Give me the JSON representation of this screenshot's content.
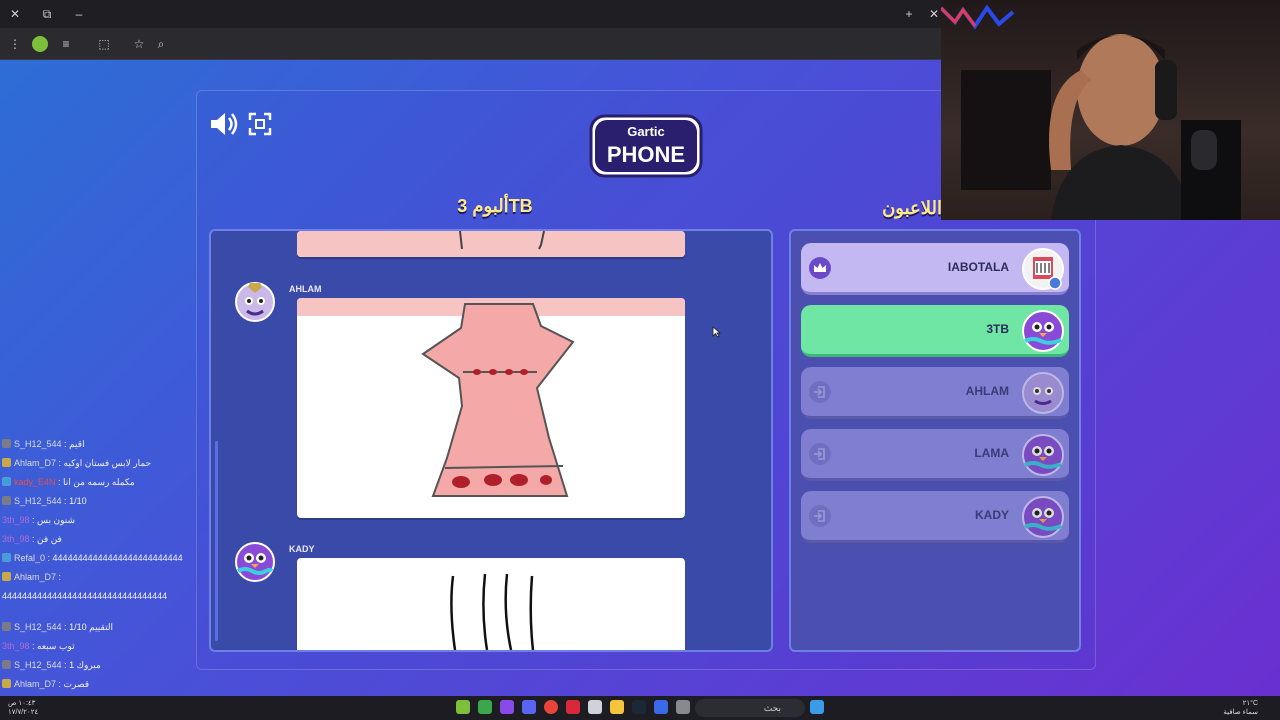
{
  "game": {
    "album_title": "ألبوم 3TB",
    "players_title": "اللاعبون",
    "album_entries": [
      {
        "player": "AHLAM"
      },
      {
        "player": "KADY"
      }
    ],
    "players": [
      {
        "name": "IABOTALA",
        "role": "host"
      },
      {
        "name": "3TB",
        "role": "current"
      },
      {
        "name": "AHLAM",
        "role": "left"
      },
      {
        "name": "LAMA",
        "role": "left"
      },
      {
        "name": "KADY",
        "role": "left"
      }
    ],
    "logo_text": {
      "top": "Gartic",
      "bottom": "PHONE"
    }
  },
  "chat": [
    {
      "user": "S_H12_544",
      "text": "اقيم",
      "icon": "x"
    },
    {
      "user": "Ahlam_D7",
      "text": "حمار لابس فستان اوكيه",
      "icon": "gold"
    },
    {
      "user": "kady_E4N",
      "text": "مكمله رسمه من انا",
      "icon": "b"
    },
    {
      "user": "S_H12_544",
      "text": "1/10",
      "icon": "x"
    },
    {
      "user": "3th_98",
      "text": "شنون بس",
      "icon": "none"
    },
    {
      "user": "3th_98",
      "text": "فن فن",
      "icon": "none"
    },
    {
      "user": "Refal_0",
      "text": "44444444444444444444444444",
      "icon": "b"
    },
    {
      "user": "Ahlam_D7",
      "text": "",
      "icon": "gold"
    },
    {
      "user": "",
      "text": "444444444444444444444444444444444",
      "icon": "none"
    },
    {
      "user": "S_H12_544",
      "text": "التقييم 1/10",
      "icon": "x"
    },
    {
      "user": "3th_98",
      "text": "ثوب سبعه",
      "icon": "none"
    },
    {
      "user": "S_H12_544",
      "text": "مبروك 1",
      "icon": "x"
    },
    {
      "user": "Ahlam_D7",
      "text": "قصرت",
      "icon": "gold"
    }
  ],
  "taskbar": {
    "search_placeholder": "بحث",
    "time": "٢١°C",
    "weather": "سماء صافية",
    "left_clock": "١٠:٤٣ ص",
    "left_date": "١٧/٧/٢٠٢٤"
  },
  "colors": {
    "players_panel": "#4b4fb0",
    "current_player": "#6fe6a4",
    "host_player": "#c4b8f3",
    "title_yellow": "#ffe88a"
  }
}
